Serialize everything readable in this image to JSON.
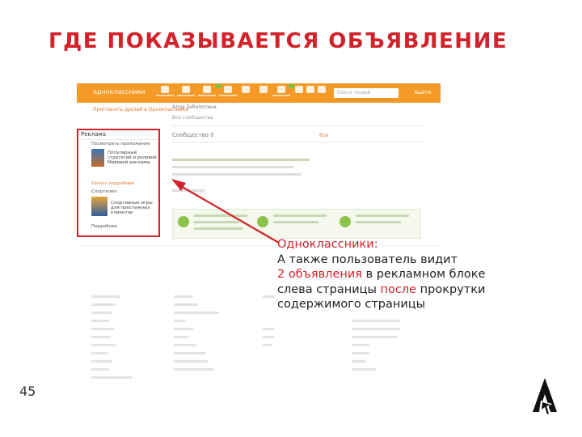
{
  "slide": {
    "title": "ГДЕ ПОКАЗЫВАЕТСЯ ОБЪЯВЛЕНИЕ",
    "page_number": "45"
  },
  "screenshot": {
    "header": {
      "logo": "одноклассники",
      "search_placeholder": "Поиск людей",
      "exit": "Выйти"
    },
    "sidebar": {
      "link": "Пригласить друзей в Одноклассники"
    },
    "main": {
      "name": "Алла Заболотина",
      "link": "Все сообщества",
      "section_title": "Сообщества 0",
      "section_action": "Все"
    },
    "ad_block": {
      "title": "Реклама",
      "ad1_caption": "Посмотреть приложение",
      "ad1_text": "Популярный стратегий и ролевой Мировой рекламы",
      "ad1_link": "Узнать подробнее",
      "ad2_caption": "Спорткомп",
      "ad2_text": "Спортивные игры для престижных клиентов",
      "ad2_more": "Подробнее"
    }
  },
  "callout": {
    "heading": "Одноклассники:",
    "line1": "А также пользователь видит",
    "line2_highlight": "2 объявления",
    "line2_rest": " в рекламном блоке",
    "line3_start": "слева страницы ",
    "line3_highlight": "после",
    "line3_rest": " прокрутки",
    "line4": "содержимого страницы"
  },
  "colors": {
    "accent_red": "#d2232a",
    "ok_orange": "#f59a27",
    "text_dark": "#222222"
  }
}
